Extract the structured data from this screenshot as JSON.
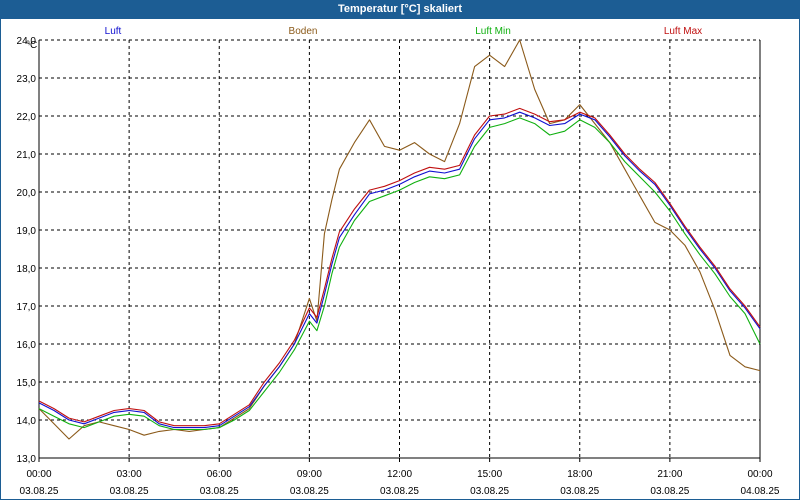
{
  "window": {
    "title": "Temperatur [°C] skaliert"
  },
  "chart_data": {
    "type": "line",
    "title": "Temperatur [°C] skaliert",
    "ylabel": "°C",
    "xlabel": "",
    "ylim": [
      13.0,
      24.0
    ],
    "xlim": [
      0,
      24
    ],
    "grid": true,
    "legend_position": "top",
    "y_ticks": [
      "24,0",
      "23,0",
      "22,0",
      "21,0",
      "20,0",
      "19,0",
      "18,0",
      "17,0",
      "16,0",
      "15,0",
      "14,0",
      "13,0"
    ],
    "x_ticks": [
      {
        "time": "00:00",
        "date": "03.08.25"
      },
      {
        "time": "03:00",
        "date": "03.08.25"
      },
      {
        "time": "06:00",
        "date": "03.08.25"
      },
      {
        "time": "09:00",
        "date": "03.08.25"
      },
      {
        "time": "12:00",
        "date": "03.08.25"
      },
      {
        "time": "15:00",
        "date": "03.08.25"
      },
      {
        "time": "18:00",
        "date": "03.08.25"
      },
      {
        "time": "21:00",
        "date": "03.08.25"
      },
      {
        "time": "00:00",
        "date": "04.08.25"
      }
    ],
    "series": [
      {
        "name": "Luft",
        "color": "#1010d0",
        "x": [
          0,
          0.5,
          1,
          1.5,
          2,
          2.5,
          3,
          3.5,
          4,
          4.5,
          5,
          5.5,
          6,
          6.5,
          7,
          7.5,
          8,
          8.5,
          9,
          9.25,
          9.5,
          9.75,
          10,
          10.5,
          11,
          11.5,
          12,
          12.5,
          13,
          13.5,
          14,
          14.5,
          15,
          15.5,
          16,
          16.5,
          17,
          17.5,
          18,
          18.5,
          19,
          19.5,
          20,
          20.5,
          21,
          21.5,
          22,
          22.5,
          23,
          23.5,
          24
        ],
        "values": [
          14.45,
          14.25,
          14.0,
          13.9,
          14.05,
          14.2,
          14.25,
          14.2,
          13.9,
          13.8,
          13.8,
          13.8,
          13.85,
          14.1,
          14.35,
          14.9,
          15.4,
          16.0,
          16.8,
          16.55,
          17.3,
          18.1,
          18.8,
          19.4,
          19.95,
          20.05,
          20.2,
          20.4,
          20.55,
          20.5,
          20.6,
          21.4,
          21.9,
          21.95,
          22.1,
          21.95,
          21.75,
          21.8,
          22.05,
          21.9,
          21.45,
          20.95,
          20.55,
          20.2,
          19.65,
          19.05,
          18.5,
          18.0,
          17.4,
          16.95,
          16.4
        ]
      },
      {
        "name": "Boden",
        "color": "#8b5a1a",
        "x": [
          0,
          0.5,
          1,
          1.5,
          2,
          2.5,
          3,
          3.5,
          4,
          4.5,
          5,
          5.5,
          6,
          6.5,
          7,
          7.5,
          8,
          8.5,
          9,
          9.25,
          9.5,
          9.75,
          10,
          10.5,
          11,
          11.5,
          12,
          12.5,
          13,
          13.5,
          14,
          14.5,
          15,
          15.5,
          16,
          16.5,
          17,
          17.5,
          18,
          18.5,
          19,
          19.5,
          20,
          20.5,
          21,
          21.5,
          22,
          22.5,
          23,
          23.5,
          24
        ],
        "values": [
          14.3,
          13.9,
          13.5,
          13.85,
          13.95,
          13.85,
          13.75,
          13.6,
          13.7,
          13.75,
          13.7,
          13.75,
          13.8,
          14.05,
          14.3,
          14.9,
          15.4,
          16.0,
          17.2,
          16.6,
          18.9,
          19.8,
          20.6,
          21.3,
          21.9,
          21.2,
          21.1,
          21.3,
          21.0,
          20.8,
          21.8,
          23.3,
          23.6,
          23.3,
          24.0,
          22.7,
          21.8,
          21.9,
          22.3,
          21.8,
          21.3,
          20.6,
          19.9,
          19.2,
          19.0,
          18.6,
          17.9,
          16.9,
          15.7,
          15.4,
          15.3
        ]
      },
      {
        "name": "Luft Min",
        "color": "#10b010",
        "x": [
          0,
          0.5,
          1,
          1.5,
          2,
          2.5,
          3,
          3.5,
          4,
          4.5,
          5,
          5.5,
          6,
          6.5,
          7,
          7.5,
          8,
          8.5,
          9,
          9.25,
          9.5,
          9.75,
          10,
          10.5,
          11,
          11.5,
          12,
          12.5,
          13,
          13.5,
          14,
          14.5,
          15,
          15.5,
          16,
          16.5,
          17,
          17.5,
          18,
          18.5,
          19,
          19.5,
          20,
          20.5,
          21,
          21.5,
          22,
          22.5,
          23,
          23.5,
          24
        ],
        "values": [
          14.3,
          14.1,
          13.9,
          13.8,
          13.95,
          14.1,
          14.15,
          14.1,
          13.85,
          13.75,
          13.75,
          13.75,
          13.8,
          14.0,
          14.25,
          14.75,
          15.25,
          15.85,
          16.6,
          16.35,
          17.0,
          17.85,
          18.55,
          19.25,
          19.75,
          19.9,
          20.05,
          20.25,
          20.4,
          20.35,
          20.45,
          21.2,
          21.7,
          21.8,
          21.95,
          21.8,
          21.5,
          21.6,
          21.9,
          21.7,
          21.3,
          20.8,
          20.4,
          20.0,
          19.5,
          18.9,
          18.35,
          17.85,
          17.25,
          16.8,
          16.0
        ]
      },
      {
        "name": "Luft Max",
        "color": "#c01010",
        "x": [
          0,
          0.5,
          1,
          1.5,
          2,
          2.5,
          3,
          3.5,
          4,
          4.5,
          5,
          5.5,
          6,
          6.5,
          7,
          7.5,
          8,
          8.5,
          9,
          9.25,
          9.5,
          9.75,
          10,
          10.5,
          11,
          11.5,
          12,
          12.5,
          13,
          13.5,
          14,
          14.5,
          15,
          15.5,
          16,
          16.5,
          17,
          17.5,
          18,
          18.5,
          19,
          19.5,
          20,
          20.5,
          21,
          21.5,
          22,
          22.5,
          23,
          23.5,
          24
        ],
        "values": [
          14.5,
          14.3,
          14.05,
          13.95,
          14.1,
          14.25,
          14.3,
          14.25,
          13.95,
          13.85,
          13.85,
          13.85,
          13.9,
          14.15,
          14.4,
          15.0,
          15.5,
          16.1,
          16.95,
          16.7,
          17.45,
          18.25,
          18.95,
          19.55,
          20.05,
          20.15,
          20.3,
          20.5,
          20.65,
          20.6,
          20.7,
          21.5,
          22.0,
          22.05,
          22.2,
          22.05,
          21.85,
          21.9,
          22.1,
          21.95,
          21.5,
          21.0,
          20.6,
          20.25,
          19.7,
          19.1,
          18.55,
          18.05,
          17.45,
          17.0,
          16.45
        ]
      }
    ]
  }
}
